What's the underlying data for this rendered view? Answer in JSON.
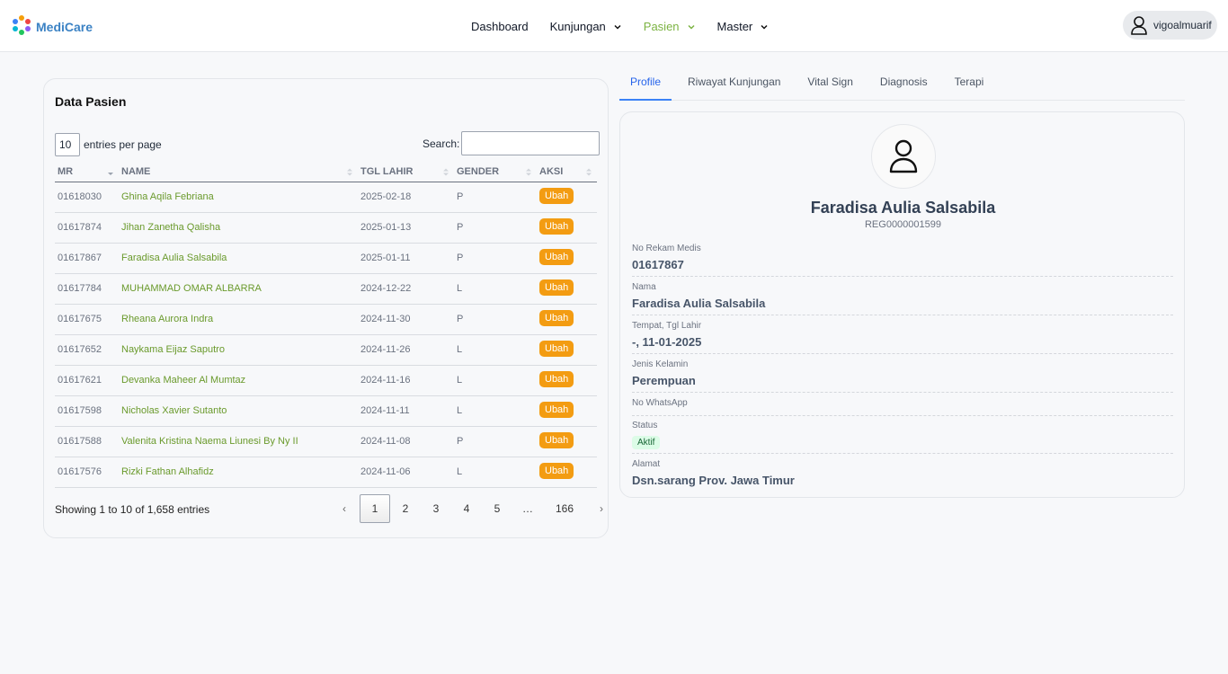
{
  "app": {
    "brand": "MediCare",
    "user": "vigoalmuarif"
  },
  "nav": [
    {
      "label": "Dashboard",
      "dropdown": false,
      "active": false
    },
    {
      "label": "Kunjungan",
      "dropdown": true,
      "active": false
    },
    {
      "label": "Pasien",
      "dropdown": true,
      "active": true
    },
    {
      "label": "Master",
      "dropdown": true,
      "active": false
    }
  ],
  "patients_panel": {
    "title": "Data Pasien",
    "entries_value": "10",
    "entries_label": "entries per page",
    "search_label": "Search:",
    "search_value": "",
    "columns": [
      "MR",
      "NAME",
      "TGL LAHIR",
      "GENDER",
      "AKSI"
    ],
    "rows": [
      {
        "mr": "01618030",
        "name": "Ghina Aqila Febriana",
        "dob": "2025-02-18",
        "gender": "P",
        "action": "Ubah"
      },
      {
        "mr": "01617874",
        "name": "Jihan Zanetha Qalisha",
        "dob": "2025-01-13",
        "gender": "P",
        "action": "Ubah"
      },
      {
        "mr": "01617867",
        "name": "Faradisa Aulia Salsabila",
        "dob": "2025-01-11",
        "gender": "P",
        "action": "Ubah"
      },
      {
        "mr": "01617784",
        "name": "MUHAMMAD OMAR ALBARRA",
        "dob": "2024-12-22",
        "gender": "L",
        "action": "Ubah"
      },
      {
        "mr": "01617675",
        "name": "Rheana Aurora Indra",
        "dob": "2024-11-30",
        "gender": "P",
        "action": "Ubah"
      },
      {
        "mr": "01617652",
        "name": "Naykama Eijaz Saputro",
        "dob": "2024-11-26",
        "gender": "L",
        "action": "Ubah"
      },
      {
        "mr": "01617621",
        "name": "Devanka Maheer Al Mumtaz",
        "dob": "2024-11-16",
        "gender": "L",
        "action": "Ubah"
      },
      {
        "mr": "01617598",
        "name": "Nicholas Xavier Sutanto",
        "dob": "2024-11-11",
        "gender": "L",
        "action": "Ubah"
      },
      {
        "mr": "01617588",
        "name": "Valenita Kristina Naema Liunesi By Ny II",
        "dob": "2024-11-08",
        "gender": "P",
        "action": "Ubah"
      },
      {
        "mr": "01617576",
        "name": "Rizki Fathan Alhafidz",
        "dob": "2024-11-06",
        "gender": "L",
        "action": "Ubah"
      }
    ],
    "showing": "Showing 1 to 10 of 1,658 entries",
    "pagination": {
      "prev": "‹",
      "next": "›",
      "pages": [
        "1",
        "2",
        "3",
        "4",
        "5",
        "…",
        "166"
      ],
      "current": "1"
    }
  },
  "detail_tabs": [
    {
      "label": "Profile",
      "active": true
    },
    {
      "label": "Riwayat Kunjungan",
      "active": false
    },
    {
      "label": "Vital Sign",
      "active": false
    },
    {
      "label": "Diagnosis",
      "active": false
    },
    {
      "label": "Terapi",
      "active": false
    }
  ],
  "profile": {
    "name": "Faradisa Aulia Salsabila",
    "reg": "REG0000001599",
    "fields": [
      {
        "label": "No Rekam Medis",
        "value": "01617867"
      },
      {
        "label": "Nama",
        "value": "Faradisa Aulia Salsabila"
      },
      {
        "label": "Tempat, Tgl Lahir",
        "value": "-, 11-01-2025"
      },
      {
        "label": "Jenis Kelamin",
        "value": "Perempuan"
      },
      {
        "label": "No WhatsApp",
        "value": ""
      },
      {
        "label": "Status",
        "badge": "Aktif"
      },
      {
        "label": "Alamat",
        "value": "Dsn.sarang Prov. Jawa Timur"
      }
    ]
  },
  "colors": {
    "accent_green": "#7cb342",
    "link_green": "#6a9a2c",
    "action_orange": "#f39c12",
    "tab_blue": "#2563eb",
    "brand_blue": "#3b82c4"
  },
  "icons": {
    "logo": "medicare-logo-icon",
    "user": "user-icon",
    "chevron": "chevron-down-icon",
    "sort": "sort-icon"
  }
}
